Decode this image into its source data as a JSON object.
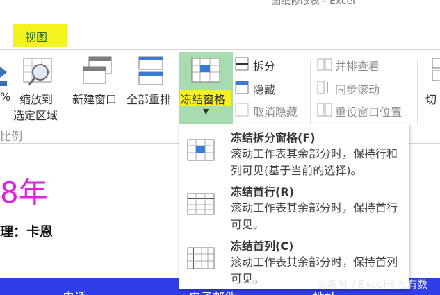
{
  "window": {
    "title": "图纸修改表 - Excel"
  },
  "tabs": {
    "view": "视图"
  },
  "ribbon": {
    "percent": "%",
    "zoom_selection": {
      "line1": "缩放到",
      "line2": "选定区域"
    },
    "group_zoom_label": "比例",
    "new_window": "新建窗口",
    "arrange_all": "全部重排",
    "freeze_panes": "冻结窗格",
    "split": "拆分",
    "hide": "隐藏",
    "unhide": "取消隐藏",
    "view_side_by_side": "并排查看",
    "sync_scroll": "同步滚动",
    "reset_window_position": "重设窗口位置",
    "switch_windows": "切"
  },
  "sheet": {
    "year_text": "8年",
    "manager_text": "理：卡恩",
    "header_cells": [
      "电话",
      "电子邮件",
      "地址"
    ]
  },
  "freeze_menu": {
    "items": [
      {
        "title": "冻结拆分窗格(F)",
        "desc": "滚动工作表其余部分时，保持行和列可见(基于当前的选择)。"
      },
      {
        "title": "冻结首行(R)",
        "desc": "滚动工作表其余部分时，保持首行可见。"
      },
      {
        "title": "冻结首列(C)",
        "desc": "滚动工作表其余部分时，保持首列可见。"
      }
    ]
  },
  "watermark": "头条号 / Excel卡恩有数",
  "colors": {
    "highlight_yellow": "#f4f31f",
    "freeze_green": "#a8dcb0",
    "year_magenta": "#e020e0",
    "header_blue": "#2f3ee8"
  }
}
